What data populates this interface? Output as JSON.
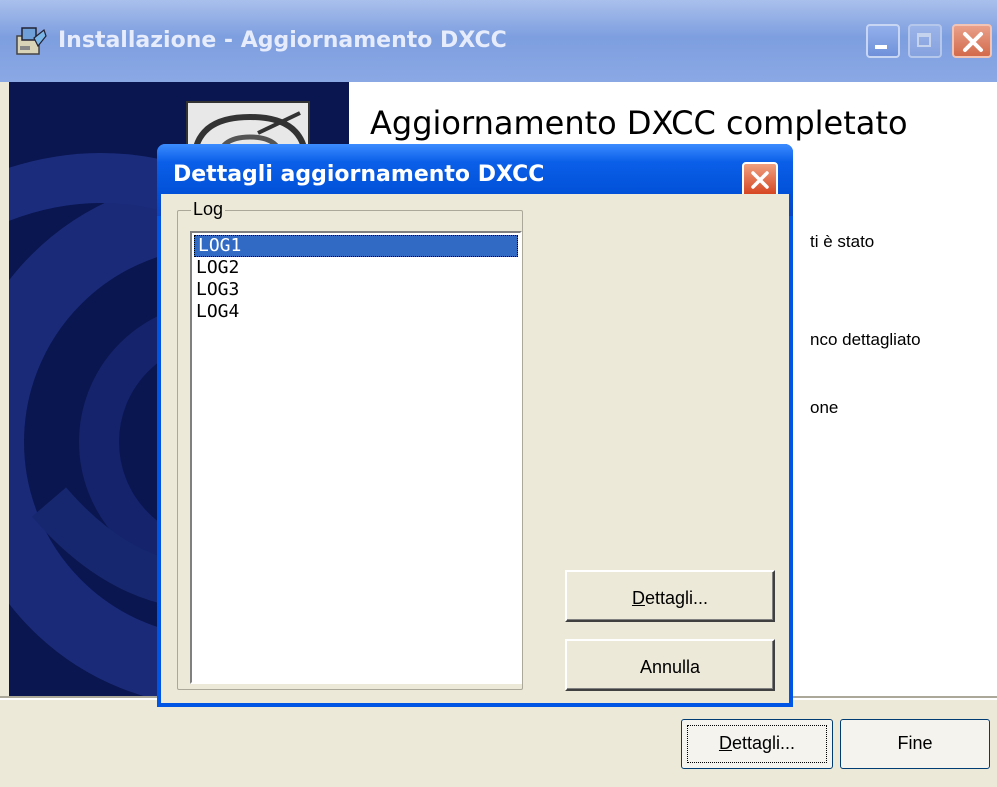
{
  "window": {
    "title": "Installazione - Aggiornamento DXCC"
  },
  "main": {
    "heading": "Aggiornamento DXCC completato",
    "text_lines": [
      "ti è stato",
      "nco dettagliato",
      "one"
    ]
  },
  "footer": {
    "details_label_underlined": "D",
    "details_label_rest": "ettagli...",
    "finish_label": "Fine"
  },
  "dialog": {
    "title": "Dettagli aggiornamento DXCC",
    "group_label": "Log",
    "log_items": [
      "LOG1",
      "LOG2",
      "LOG3",
      "LOG4"
    ],
    "selected_index": 0,
    "details_label_underlined": "D",
    "details_label_rest": "ettagli...",
    "cancel_label": "Annulla"
  }
}
